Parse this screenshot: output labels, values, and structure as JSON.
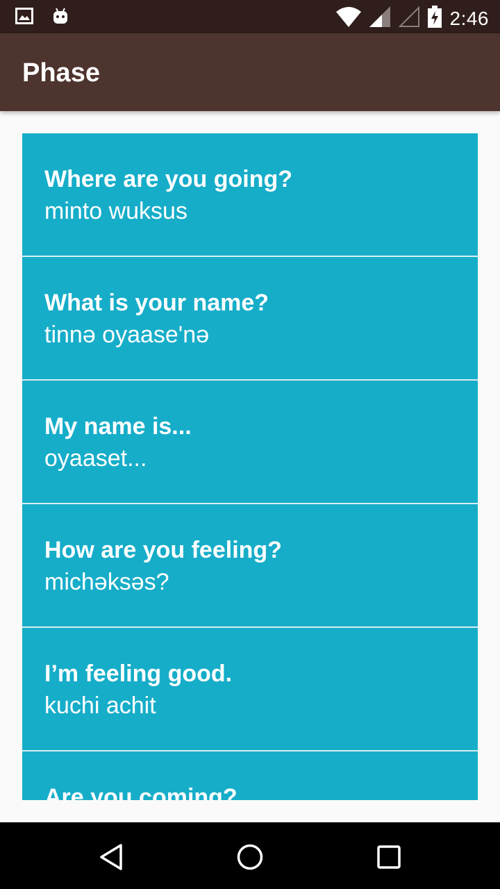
{
  "status_bar": {
    "time": "2:46",
    "icons": [
      "image-icon",
      "android-icon",
      "wifi-icon",
      "signal-icon",
      "signal-empty-icon",
      "battery-charging-icon"
    ]
  },
  "app_bar": {
    "title": "Phase",
    "background_color": "#4e342e"
  },
  "phrases": [
    {
      "english": "Where are you going?",
      "native": "minto wuksus"
    },
    {
      "english": "What is your name?",
      "native": "tinnə oyaase'nə"
    },
    {
      "english": "My name is...",
      "native": "oyaaset..."
    },
    {
      "english": "How are you feeling?",
      "native": "michəksəs?"
    },
    {
      "english": "I’m feeling good.",
      "native": "kuchi achit"
    },
    {
      "english": "Are you coming?",
      "native": ""
    }
  ],
  "colors": {
    "list_background": "#16adc9",
    "status_bar": "#2f1e1b",
    "nav_bar": "#000000"
  },
  "nav_bar": {
    "icons": [
      "back-icon",
      "home-icon",
      "recents-icon"
    ]
  }
}
